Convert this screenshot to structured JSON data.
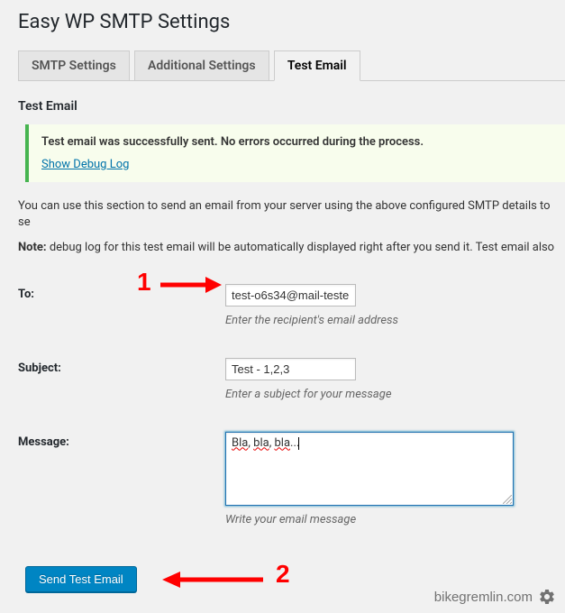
{
  "page": {
    "title": "Easy WP SMTP Settings"
  },
  "tabs": [
    {
      "label": "SMTP Settings",
      "active": false
    },
    {
      "label": "Additional Settings",
      "active": false
    },
    {
      "label": "Test Email",
      "active": true
    }
  ],
  "section": {
    "heading": "Test Email"
  },
  "notice": {
    "message": "Test email was successfully sent. No errors occurred during the process.",
    "link": "Show Debug Log"
  },
  "intro": {
    "line1": "You can use this section to send an email from your server using the above configured SMTP details to se",
    "note_label": "Note:",
    "note_text": " debug log for this test email will be automatically displayed right after you send it. Test email also "
  },
  "form": {
    "to": {
      "label": "To:",
      "value": "test-o6s34@mail-teste",
      "hint": "Enter the recipient's email address"
    },
    "subject": {
      "label": "Subject:",
      "value": "Test - 1,2,3",
      "hint": "Enter a subject for your message"
    },
    "message": {
      "label": "Message:",
      "value_pre": "Bla, bla, bla...",
      "w1": "Bla",
      "sep": ", ",
      "w2": "bla",
      "w3": "bla",
      "tail": "...",
      "hint": "Write your email message"
    },
    "submit": "Send Test Email"
  },
  "annotations": {
    "one": "1",
    "two": "2"
  },
  "watermark": "bikegremlin.com"
}
